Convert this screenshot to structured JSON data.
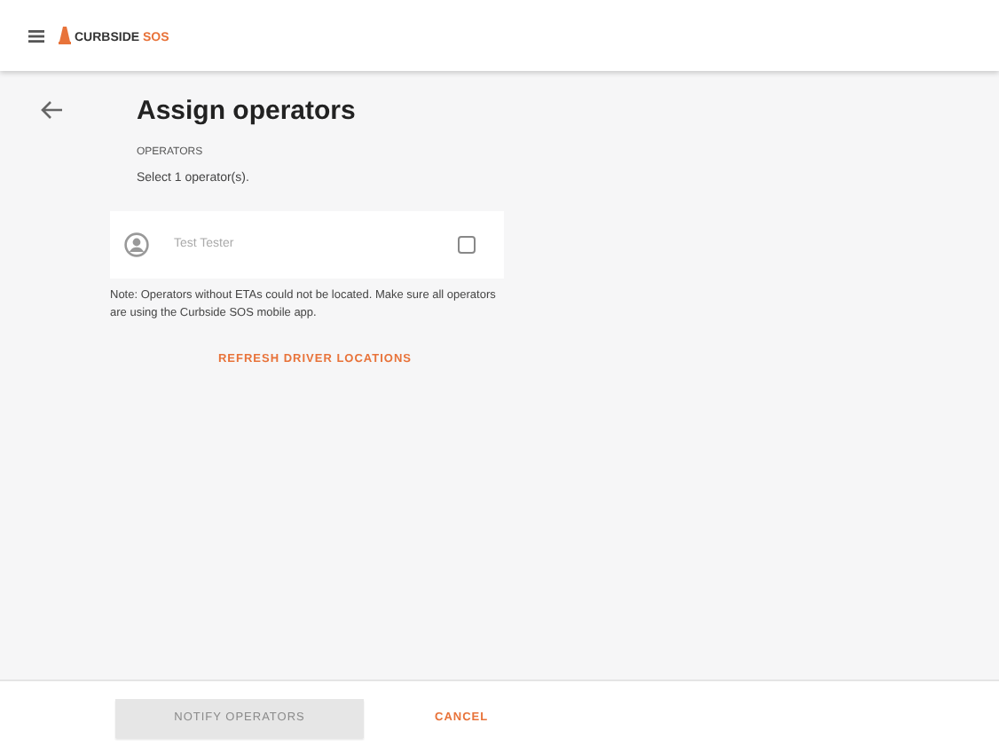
{
  "header": {
    "logo_text": "CURBSIDE",
    "logo_accent": "SOS"
  },
  "page": {
    "title": "Assign operators",
    "section_label": "OPERATORS",
    "instruction": "Select 1 operator(s)."
  },
  "operators": [
    {
      "name": "Test Tester",
      "checked": false
    }
  ],
  "note": "Note: Operators without ETAs could not be located. Make sure all operators are using the Curbside SOS mobile app.",
  "refresh_link": "REFRESH DRIVER LOCATIONS",
  "footer": {
    "notify_button": {
      "label": "NOTIFY OPERATORS",
      "disabled": true
    },
    "cancel_button": "CANCEL"
  }
}
